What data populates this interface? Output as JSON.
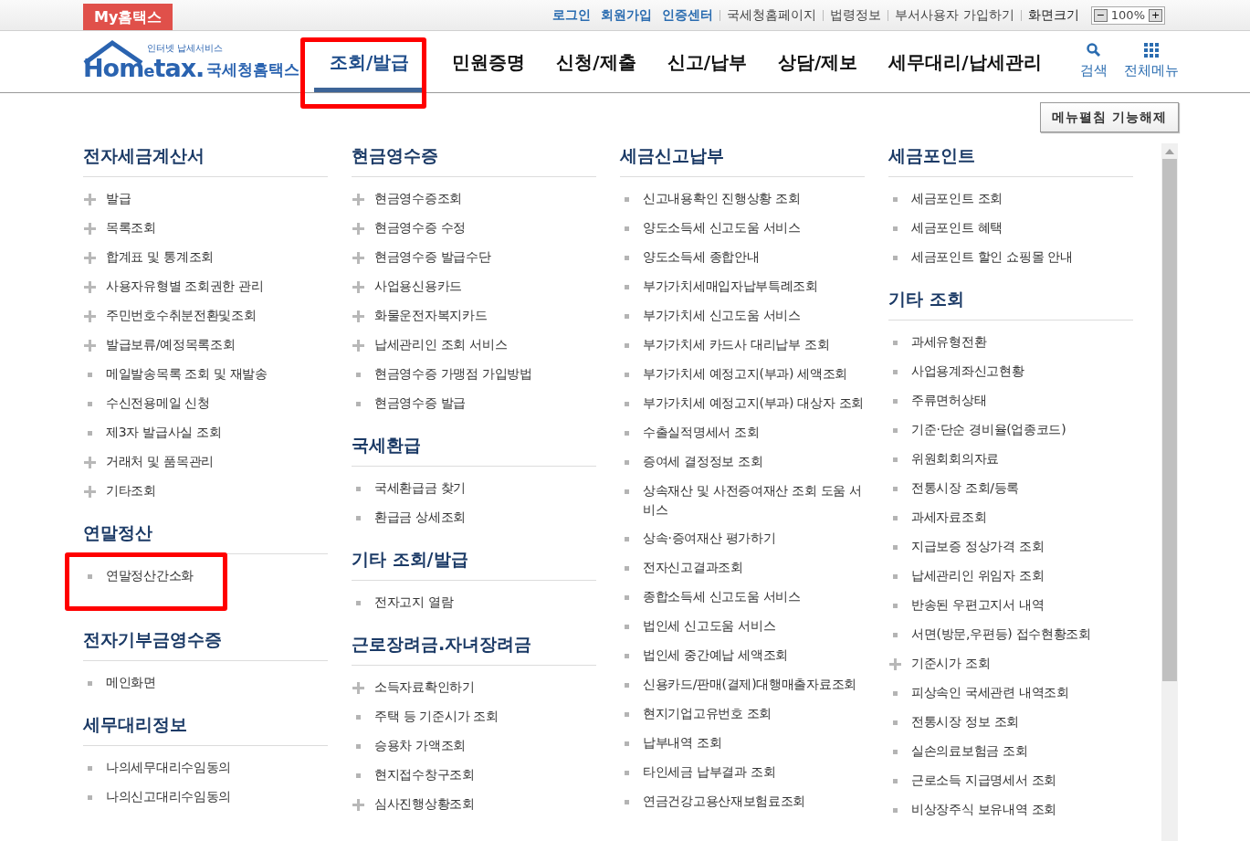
{
  "top_bar": {
    "brand": "My홈택스",
    "links": [
      {
        "label": "로그인",
        "kind": "primary"
      },
      {
        "label": "회원가입",
        "kind": "primary"
      },
      {
        "label": "인증센터",
        "kind": "primary"
      },
      {
        "label": "국세청홈페이지",
        "kind": "plain"
      },
      {
        "label": "법령정보",
        "kind": "plain"
      },
      {
        "label": "부서사용자 가입하기",
        "kind": "plain"
      },
      {
        "label": "화면크기",
        "kind": "label"
      }
    ],
    "zoom": {
      "minus": "−",
      "value": "100%",
      "plus": "+"
    }
  },
  "header": {
    "logo": {
      "tagline": "인터넷 납세서비스",
      "name_a": "Hom",
      "name_e": "e",
      "name_b": "tax.",
      "name_kr": "국세청홈택스"
    },
    "nav": [
      {
        "label": "조회/발급",
        "selected": true,
        "highlighted": true
      },
      {
        "label": "민원증명",
        "selected": false,
        "highlighted": false
      },
      {
        "label": "신청/제출",
        "selected": false,
        "highlighted": false
      },
      {
        "label": "신고/납부",
        "selected": false,
        "highlighted": false
      },
      {
        "label": "상담/제보",
        "selected": false,
        "highlighted": false
      },
      {
        "label": "세무대리/납세관리",
        "selected": false,
        "highlighted": false
      }
    ],
    "search": "검색",
    "all_menu": "전체메뉴"
  },
  "menu_toggle": "메뉴펼침 기능해제",
  "columns": [
    [
      {
        "title": "전자세금계산서",
        "items": [
          {
            "label": "발급",
            "kind": "plus"
          },
          {
            "label": "목록조회",
            "kind": "plus"
          },
          {
            "label": "합계표 및 통계조회",
            "kind": "plus"
          },
          {
            "label": "사용자유형별 조회권한 관리",
            "kind": "plus"
          },
          {
            "label": "주민번호수취분전환및조회",
            "kind": "plus"
          },
          {
            "label": "발급보류/예정목록조회",
            "kind": "plus"
          },
          {
            "label": "메일발송목록 조회 및 재발송",
            "kind": "bullet"
          },
          {
            "label": "수신전용메일 신청",
            "kind": "bullet"
          },
          {
            "label": "제3자 발급사실 조회",
            "kind": "bullet"
          },
          {
            "label": "거래처 및 품목관리",
            "kind": "plus"
          },
          {
            "label": "기타조회",
            "kind": "plus"
          }
        ]
      },
      {
        "title": "연말정산",
        "items": [
          {
            "label": "연말정산간소화",
            "kind": "bullet",
            "highlighted": true
          }
        ]
      },
      {
        "title": "전자기부금영수증",
        "items": [
          {
            "label": "메인화면",
            "kind": "bullet"
          }
        ]
      },
      {
        "title": "세무대리정보",
        "items": [
          {
            "label": "나의세무대리수임동의",
            "kind": "bullet"
          },
          {
            "label": "나의신고대리수임동의",
            "kind": "bullet"
          }
        ]
      }
    ],
    [
      {
        "title": "현금영수증",
        "items": [
          {
            "label": "현금영수증조회",
            "kind": "plus"
          },
          {
            "label": "현금영수증 수정",
            "kind": "plus"
          },
          {
            "label": "현금영수증 발급수단",
            "kind": "plus"
          },
          {
            "label": "사업용신용카드",
            "kind": "plus"
          },
          {
            "label": "화물운전자복지카드",
            "kind": "plus"
          },
          {
            "label": "납세관리인 조회 서비스",
            "kind": "plus"
          },
          {
            "label": "현금영수증 가맹점 가입방법",
            "kind": "bullet"
          },
          {
            "label": "현금영수증 발급",
            "kind": "bullet"
          }
        ]
      },
      {
        "title": "국세환급",
        "items": [
          {
            "label": "국세환급금 찾기",
            "kind": "bullet"
          },
          {
            "label": "환급금 상세조회",
            "kind": "bullet"
          }
        ]
      },
      {
        "title": "기타 조회/발급",
        "items": [
          {
            "label": "전자고지 열람",
            "kind": "bullet"
          }
        ]
      },
      {
        "title": "근로장려금.자녀장려금",
        "items": [
          {
            "label": "소득자료확인하기",
            "kind": "plus"
          },
          {
            "label": "주택 등 기준시가 조회",
            "kind": "bullet"
          },
          {
            "label": "승용차 가액조회",
            "kind": "bullet"
          },
          {
            "label": "현지접수창구조회",
            "kind": "bullet"
          },
          {
            "label": "심사진행상황조회",
            "kind": "plus"
          }
        ]
      }
    ],
    [
      {
        "title": "세금신고납부",
        "items": [
          {
            "label": "신고내용확인 진행상황 조회",
            "kind": "bullet"
          },
          {
            "label": "양도소득세 신고도움 서비스",
            "kind": "bullet"
          },
          {
            "label": "양도소득세 종합안내",
            "kind": "bullet"
          },
          {
            "label": "부가가치세매입자납부특례조회",
            "kind": "bullet"
          },
          {
            "label": "부가가치세 신고도움 서비스",
            "kind": "bullet"
          },
          {
            "label": "부가가치세 카드사 대리납부 조회",
            "kind": "bullet"
          },
          {
            "label": "부가가치세 예정고지(부과) 세액조회",
            "kind": "bullet"
          },
          {
            "label": "부가가치세 예정고지(부과) 대상자 조회",
            "kind": "bullet"
          },
          {
            "label": "수출실적명세서 조회",
            "kind": "bullet"
          },
          {
            "label": "증여세 결정정보 조회",
            "kind": "bullet"
          },
          {
            "label": "상속재산 및 사전증여재산 조회 도움 서비스",
            "kind": "bullet"
          },
          {
            "label": "상속·증여재산 평가하기",
            "kind": "bullet"
          },
          {
            "label": "전자신고결과조회",
            "kind": "bullet"
          },
          {
            "label": "종합소득세 신고도움 서비스",
            "kind": "bullet"
          },
          {
            "label": "법인세 신고도움 서비스",
            "kind": "bullet"
          },
          {
            "label": "법인세 중간예납 세액조회",
            "kind": "bullet"
          },
          {
            "label": "신용카드/판매(결제)대행매출자료조회",
            "kind": "bullet"
          },
          {
            "label": "현지기업고유번호 조회",
            "kind": "bullet"
          },
          {
            "label": "납부내역 조회",
            "kind": "bullet"
          },
          {
            "label": "타인세금 납부결과 조회",
            "kind": "bullet"
          },
          {
            "label": "연금건강고용산재보험료조회",
            "kind": "bullet"
          }
        ]
      }
    ],
    [
      {
        "title": "세금포인트",
        "items": [
          {
            "label": "세금포인트 조회",
            "kind": "bullet"
          },
          {
            "label": "세금포인트 혜택",
            "kind": "bullet"
          },
          {
            "label": "세금포인트 할인 쇼핑몰 안내",
            "kind": "bullet"
          }
        ]
      },
      {
        "title": "기타 조회",
        "items": [
          {
            "label": "과세유형전환",
            "kind": "bullet"
          },
          {
            "label": "사업용계좌신고현황",
            "kind": "bullet"
          },
          {
            "label": "주류면허상태",
            "kind": "bullet"
          },
          {
            "label": "기준·단순 경비율(업종코드)",
            "kind": "bullet"
          },
          {
            "label": "위원회회의자료",
            "kind": "bullet"
          },
          {
            "label": "전통시장 조회/등록",
            "kind": "bullet"
          },
          {
            "label": "과세자료조회",
            "kind": "bullet"
          },
          {
            "label": "지급보증 정상가격 조회",
            "kind": "bullet"
          },
          {
            "label": "납세관리인 위임자 조회",
            "kind": "bullet"
          },
          {
            "label": "반송된 우편고지서 내역",
            "kind": "bullet"
          },
          {
            "label": "서면(방문,우편등) 접수현황조회",
            "kind": "bullet"
          },
          {
            "label": "기준시가 조회",
            "kind": "plus"
          },
          {
            "label": "피상속인 국세관련 내역조회",
            "kind": "bullet"
          },
          {
            "label": "전통시장 정보 조회",
            "kind": "bullet"
          },
          {
            "label": "실손의료보험금 조회",
            "kind": "bullet"
          },
          {
            "label": "근로소득 지급명세서 조회",
            "kind": "bullet"
          },
          {
            "label": "비상장주식 보유내역 조회",
            "kind": "bullet"
          }
        ]
      }
    ]
  ]
}
